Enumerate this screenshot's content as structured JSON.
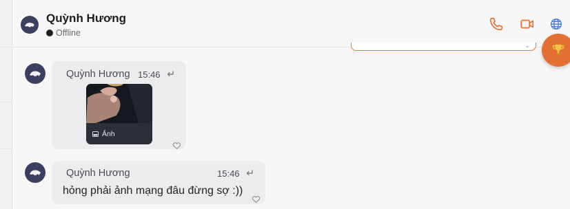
{
  "header": {
    "contact_name": "Quỳnh Hương",
    "status_text": "Offline",
    "status_color": "#222222",
    "icons": [
      "phone-icon",
      "video-call-icon",
      "globe-icon"
    ],
    "accent_color": "#e46f32"
  },
  "fab": {
    "icon": "trophy-icon"
  },
  "messages": [
    {
      "sender": "Quỳnh Hương",
      "time": "15:46",
      "type": "image",
      "image_caption": "Ảnh"
    },
    {
      "sender": "Quỳnh Hương",
      "time": "15:46",
      "type": "text",
      "text": "hỏng phải ảnh mạng đâu đừng sợ :))"
    }
  ]
}
